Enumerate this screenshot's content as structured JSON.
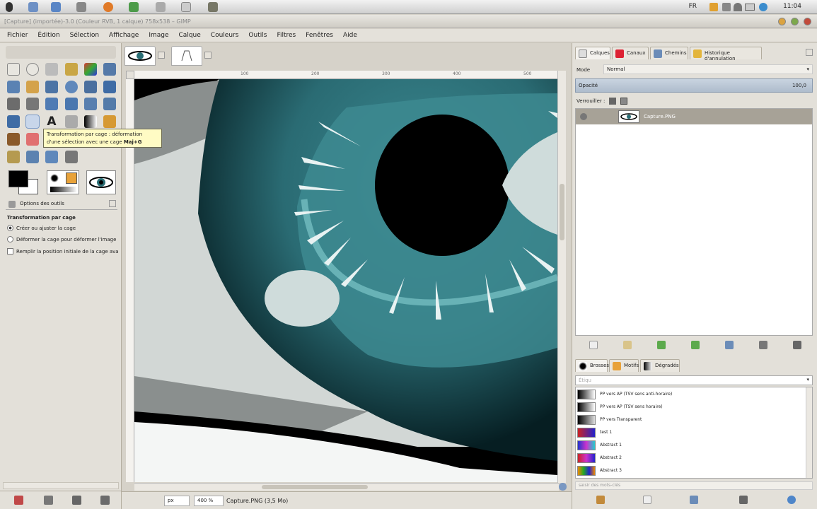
{
  "system": {
    "lang": "FR",
    "clock": "11:04"
  },
  "window": {
    "title": "[Capture] (importée)-3.0 (Couleur RVB, 1 calque) 758x538 – GIMP"
  },
  "menu": [
    "Fichier",
    "Édition",
    "Sélection",
    "Affichage",
    "Image",
    "Calque",
    "Couleurs",
    "Outils",
    "Filtres",
    "Fenêtres",
    "Aide"
  ],
  "tooltip": {
    "line1": "Transformation par cage : déformation",
    "line2": "d'une sélection avec une cage",
    "shortcut": "Maj+G"
  },
  "tool_options": {
    "tab_label": "Options des outils",
    "title": "Transformation par cage",
    "options": [
      "Créer ou ajuster la cage",
      "Déformer la cage pour déformer l'image",
      "Remplir la position initiale de la cage ava"
    ]
  },
  "canvas": {
    "ruler_marks": [
      "100",
      "200",
      "300",
      "400",
      "500",
      "600",
      "700"
    ]
  },
  "status": {
    "unit": "px",
    "zoom": "400 %",
    "text": "Capture.PNG (3,5 Mo)"
  },
  "dock": {
    "tabs": [
      "Calques",
      "Canaux",
      "Chemins",
      "Historique d'annulation"
    ],
    "mode_label": "Mode",
    "mode_value": "Normal",
    "opacity_label": "Opacité",
    "opacity_value": "100,0",
    "lock_label": "Verrouiller :",
    "layer_name": "Capture.PNG",
    "bottom_tabs": [
      "Brosses",
      "Motifs",
      "Dégradés"
    ],
    "filter_placeholder": "Étiqu",
    "gradients": [
      "PP vers AP (TSV sens anti-horaire)",
      "PP vers AP (TSV sens horaire)",
      "PP vers Transparent",
      "test 1",
      "Abstract 1",
      "Abstract 2",
      "Abstract 3"
    ],
    "search_placeholder": "saisir des mots-clés"
  },
  "colors": {
    "iris_dark": "#0b3a40",
    "iris_mid": "#3c8a92",
    "iris_light": "#5aa1a6",
    "pupil": "#000000",
    "highlight": "#cfdcdb"
  }
}
